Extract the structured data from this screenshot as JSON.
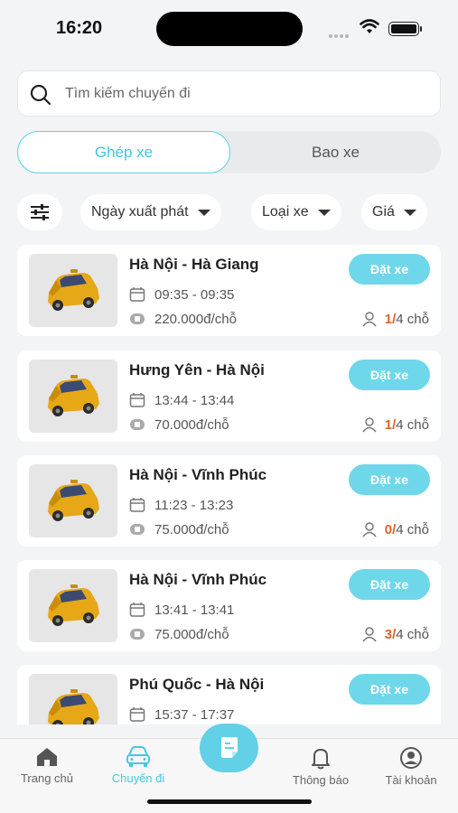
{
  "status_bar": {
    "time": "16:20"
  },
  "search": {
    "placeholder": "Tìm kiếm chuyến đi"
  },
  "segment": {
    "active": "Ghép xe",
    "inactive": "Bao xe"
  },
  "filters": {
    "departure_date": "Ngày xuất phát",
    "vehicle_type": "Loại xe",
    "price": "Giá"
  },
  "book_label": "Đặt xe",
  "trips": [
    {
      "route": "Hà Nội - Hà Giang",
      "time": "09:35 - 09:35",
      "price": "220.000đ/chỗ",
      "booked": "1/",
      "total": "4 chỗ"
    },
    {
      "route": "Hưng Yên - Hà Nội",
      "time": "13:44 - 13:44",
      "price": "70.000đ/chỗ",
      "booked": "1/",
      "total": "4 chỗ"
    },
    {
      "route": "Hà Nội - Vĩnh Phúc",
      "time": "11:23 - 13:23",
      "price": "75.000đ/chỗ",
      "booked": "0/",
      "total": "4 chỗ"
    },
    {
      "route": "Hà Nội - Vĩnh Phúc",
      "time": "13:41 - 13:41",
      "price": "75.000đ/chỗ",
      "booked": "3/",
      "total": "4 chỗ"
    },
    {
      "route": "Phú Quốc - Hà Nội",
      "time": "15:37 - 17:37",
      "price": "",
      "booked": "",
      "total": ""
    }
  ],
  "tabs": {
    "home": "Trang chủ",
    "trips": "Chuyến đi",
    "notifications": "Thông báo",
    "account": "Tài khoản"
  },
  "colors": {
    "accent": "#55d3ea",
    "book_button": "#6fd7ea",
    "seat_highlight": "#e2602a",
    "car": "#e6a817"
  },
  "icons": {
    "search": "search-icon",
    "filter": "sliders-icon",
    "calendar": "calendar-icon",
    "price": "cash-icon",
    "person": "person-icon",
    "home": "home-icon",
    "trips": "car-icon",
    "center": "document-icon",
    "notifications": "bell-icon",
    "account": "user-circle-icon"
  }
}
